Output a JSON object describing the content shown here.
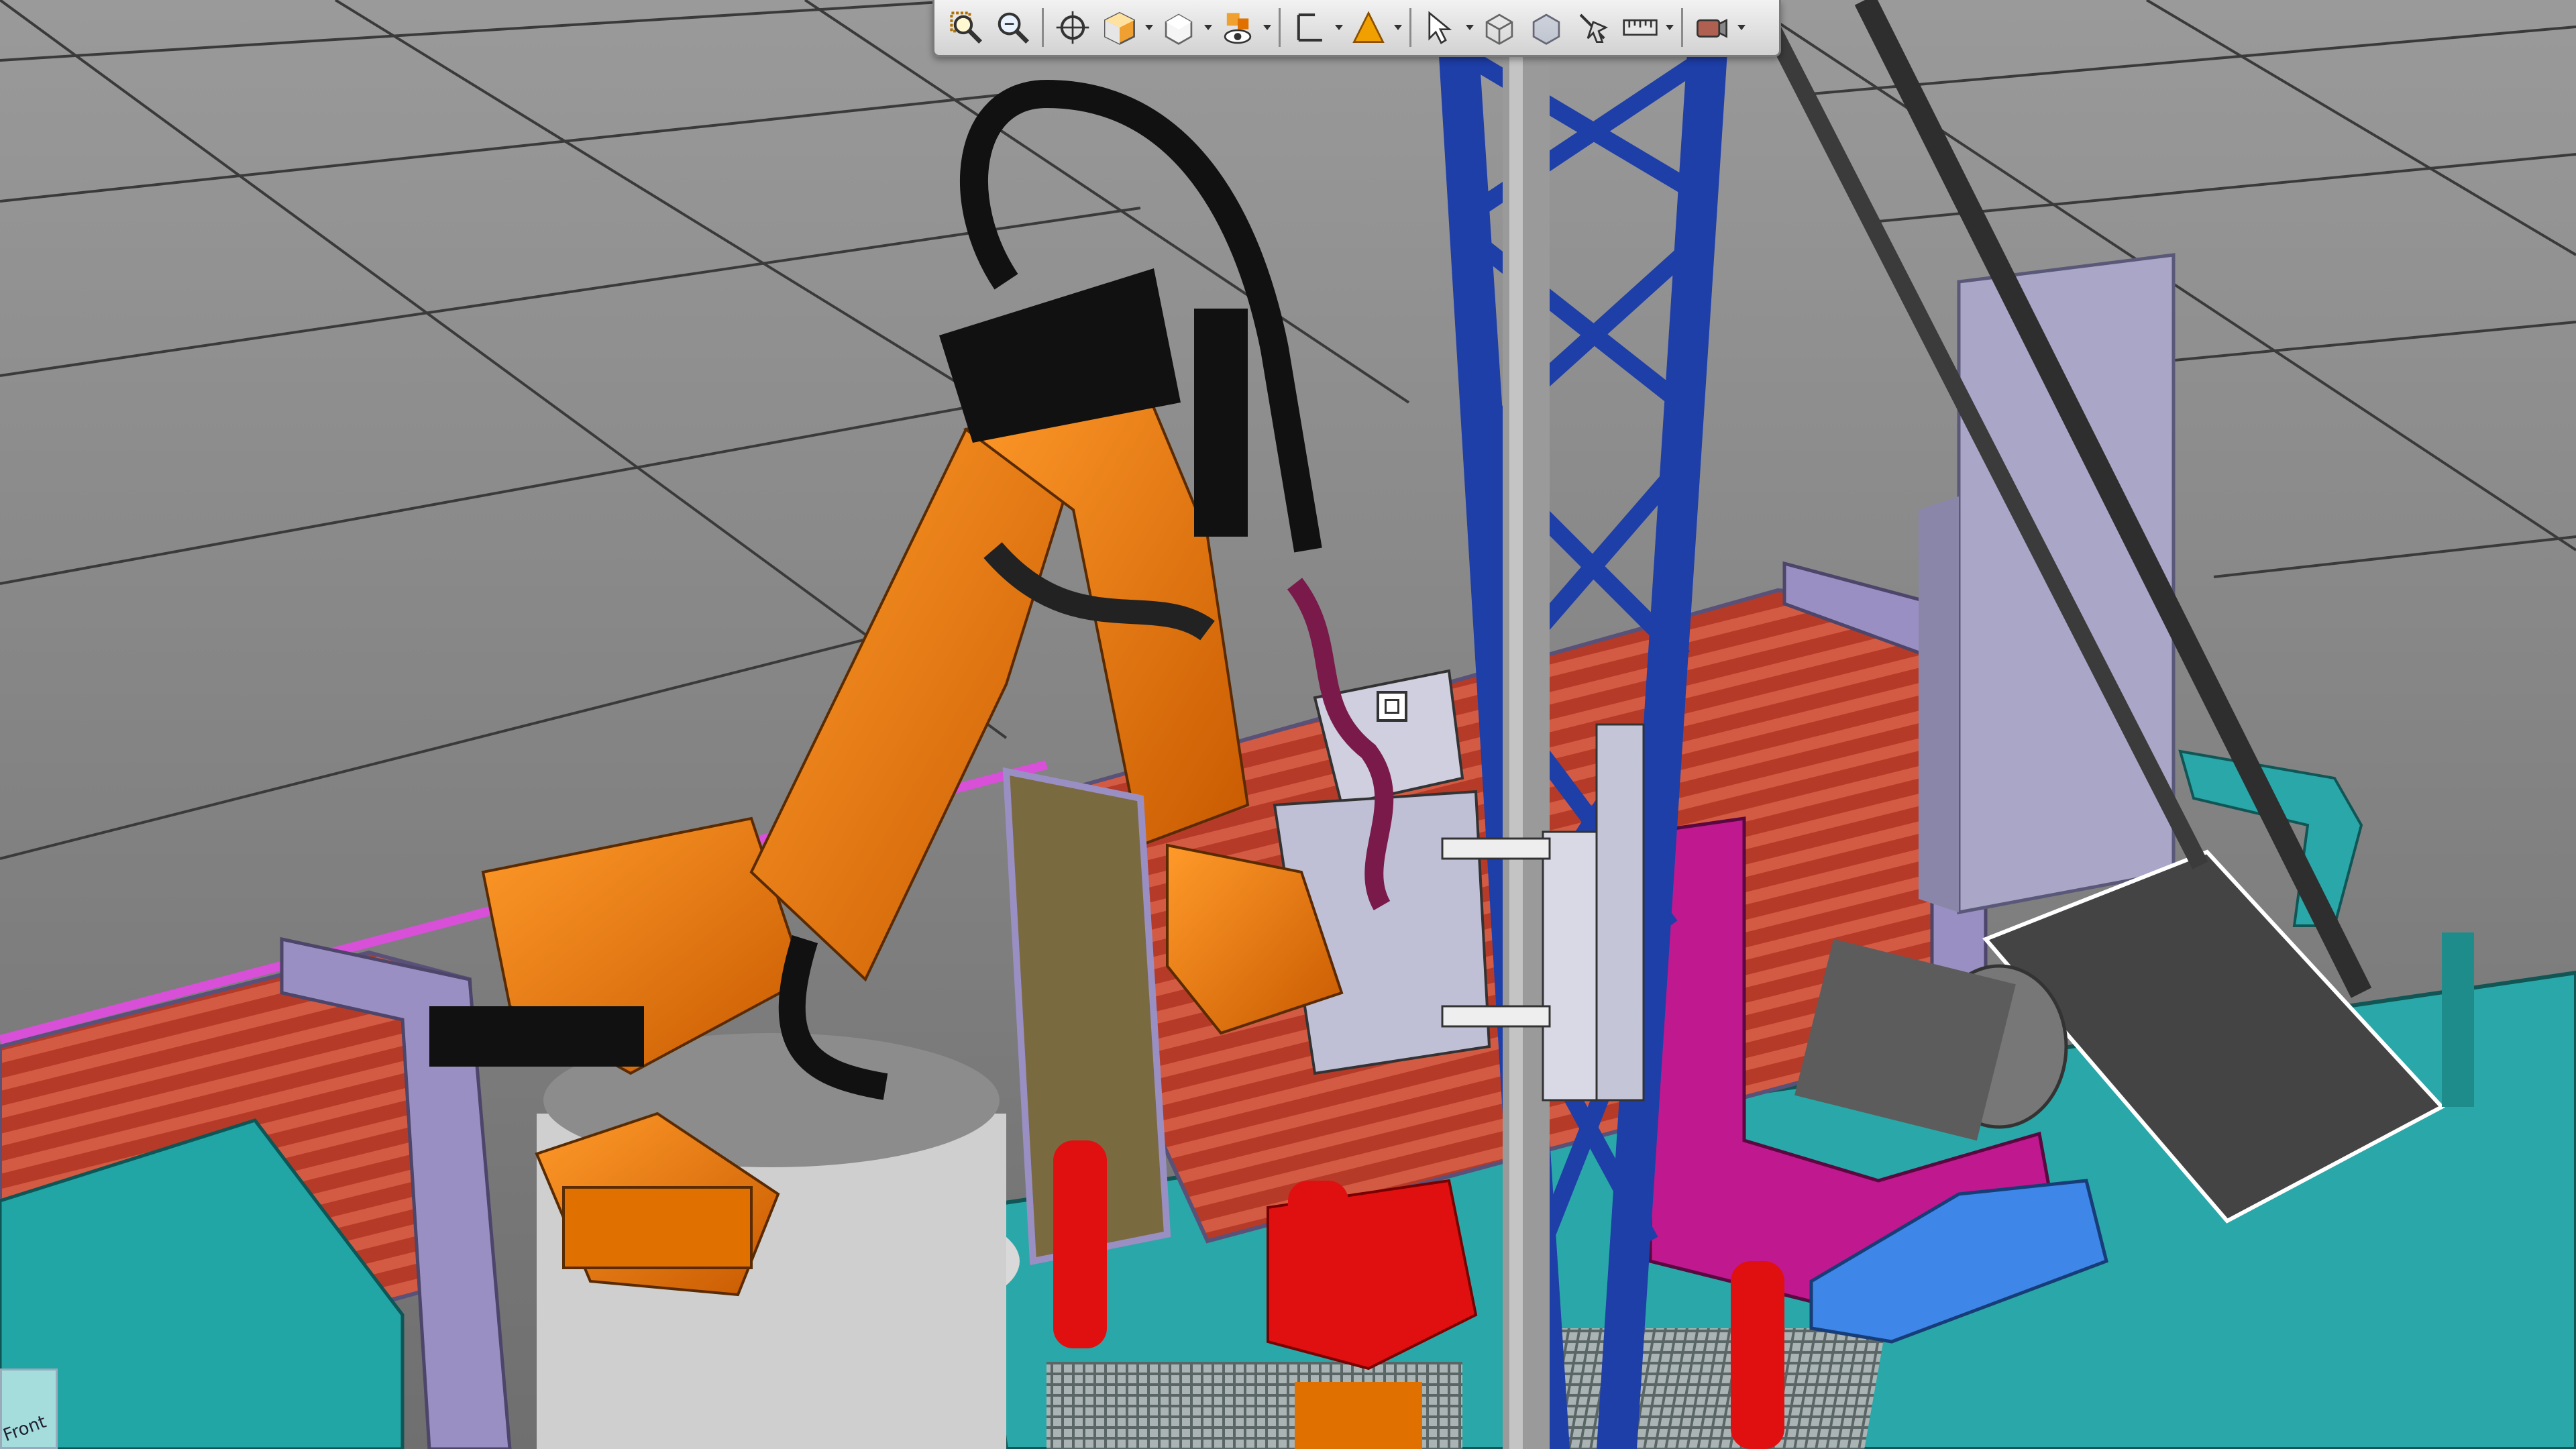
{
  "app": {
    "view_cube_label": "Front"
  },
  "toolbar": {
    "buttons": [
      {
        "id": "zoom-window",
        "icon": "zoom-window-icon"
      },
      {
        "id": "zoom",
        "icon": "zoom-icon"
      },
      {
        "id": "center",
        "icon": "crosshair-icon"
      },
      {
        "id": "render-mode",
        "icon": "shaded-cube-icon",
        "has_dropdown": true
      },
      {
        "id": "view-mode",
        "icon": "solid-box-icon",
        "has_dropdown": true
      },
      {
        "id": "visibility",
        "icon": "eye-icon",
        "has_dropdown": true
      },
      {
        "id": "frames",
        "icon": "frame-axes-icon",
        "has_dropdown": true
      },
      {
        "id": "snap-point",
        "icon": "orange-triangle-icon",
        "has_dropdown": true
      },
      {
        "id": "select",
        "icon": "pointer-select-icon",
        "has_dropdown": true
      },
      {
        "id": "box-select",
        "icon": "wire-box-icon"
      },
      {
        "id": "transparent-box",
        "icon": "transparent-box-icon"
      },
      {
        "id": "jog",
        "icon": "jog-hand-icon"
      },
      {
        "id": "measure",
        "icon": "ruler-icon",
        "has_dropdown": true
      },
      {
        "id": "record",
        "icon": "camera-icon",
        "has_dropdown": true
      }
    ]
  },
  "colors": {
    "floor": "#8d8d8d",
    "grid": "#3a3a3a",
    "robot": "#f07800",
    "tower": "#1e3ea8",
    "pipes": "#c0402c",
    "deck": "#2aa7a8",
    "frame_purple": "#9a8fc2",
    "magenta": "#c0188f",
    "red_part": "#e01010",
    "blue_part": "#3e86e8"
  }
}
